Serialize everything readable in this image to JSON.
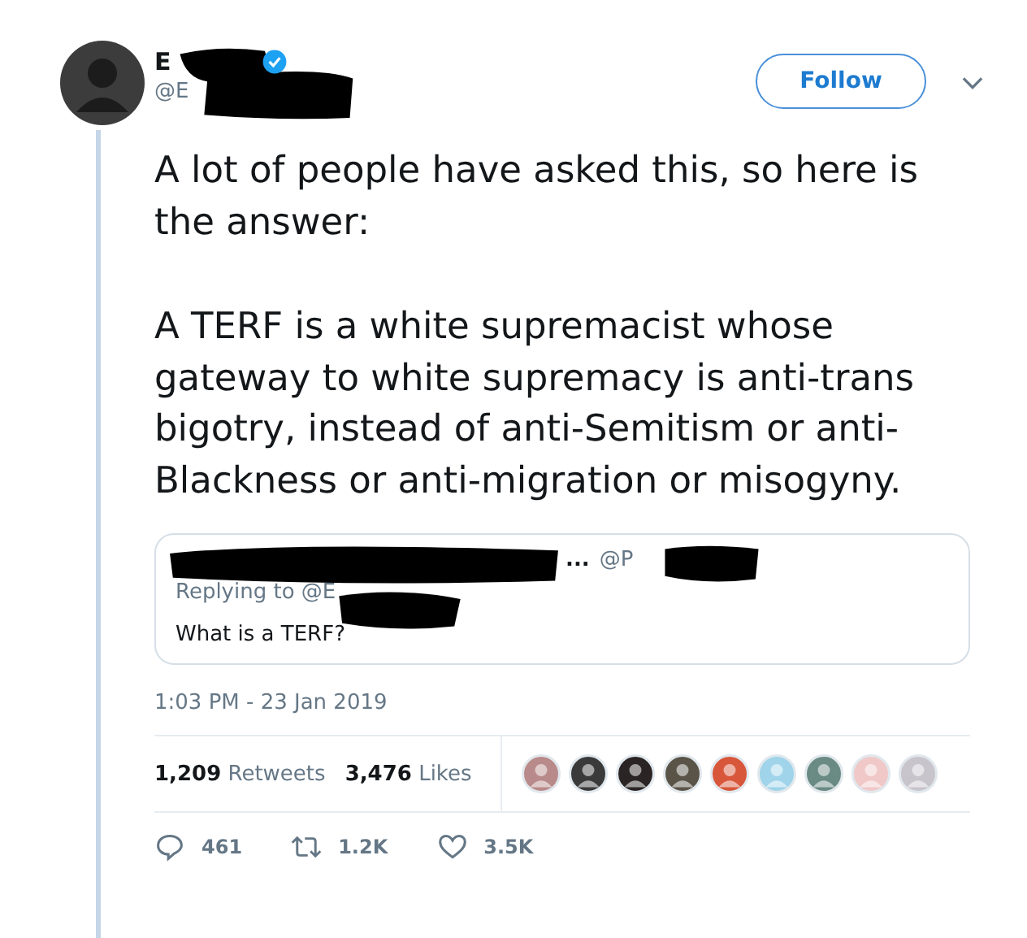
{
  "author": {
    "name": "E",
    "handle": "@E",
    "verified": true
  },
  "follow_button": {
    "label": "Follow"
  },
  "tweet_text": [
    "A lot of people have asked this, so here is the answer:",
    "A TERF is a white supremacist whose gateway to white supremacy is anti-trans bigotry, instead of anti-Semitism or anti-Blackness or anti-migration or misogyny."
  ],
  "quoted_tweet": {
    "author": "...",
    "handle": "@P",
    "replying_to": "Replying to @E",
    "text": "What is a TERF?"
  },
  "timestamp": "1:03 PM - 23 Jan 2019",
  "stats": [
    {
      "count": "1,209",
      "label": "Retweets"
    },
    {
      "count": "3,476",
      "label": "Likes"
    }
  ],
  "liker_avatars": [
    {
      "color": "#b98a8a"
    },
    {
      "color": "#3a3a3a"
    },
    {
      "color": "#2a2424"
    },
    {
      "color": "#5a5448"
    },
    {
      "color": "#d8563a"
    },
    {
      "color": "#9fd4ea"
    },
    {
      "color": "#6a8a84"
    },
    {
      "color": "#f0c8c8"
    },
    {
      "color": "#c8c4cc"
    }
  ],
  "actions": [
    {
      "kind": "reply",
      "count": "461"
    },
    {
      "kind": "retweet",
      "count": "1.2K"
    },
    {
      "kind": "like",
      "count": "3.5K"
    }
  ]
}
